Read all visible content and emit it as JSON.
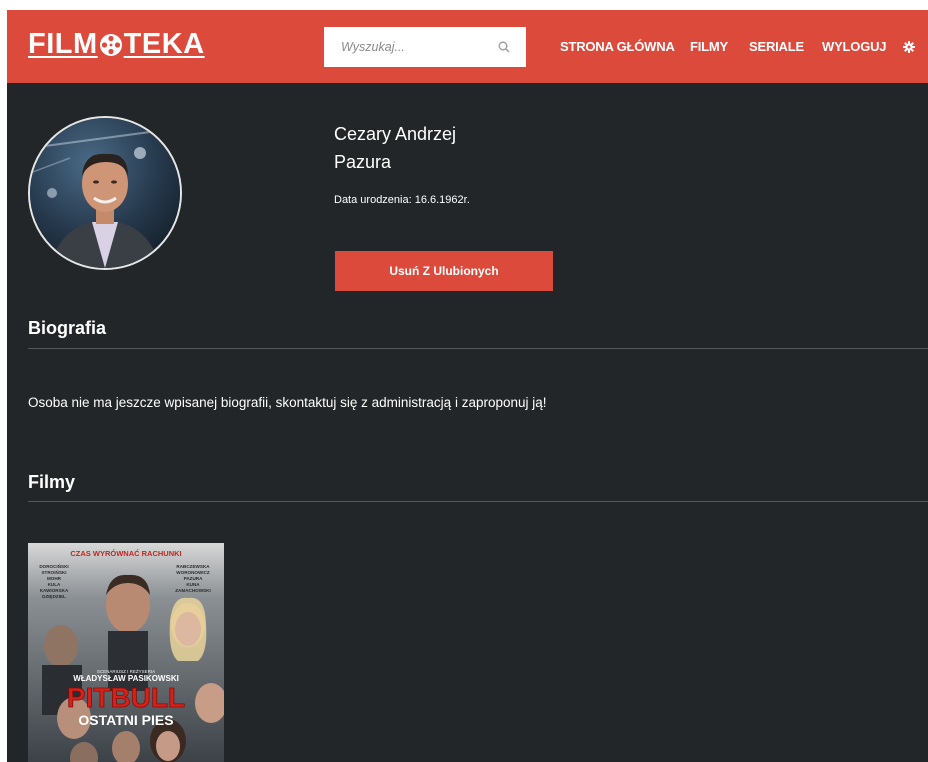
{
  "header": {
    "logo": {
      "before": "FILM",
      "after": "TEKA"
    },
    "search": {
      "placeholder": "Wyszukaj..."
    },
    "nav": [
      "STRONA GŁÓWNA",
      "FILMY",
      "SERIALE",
      "WYLOGUJ"
    ]
  },
  "person": {
    "first_names": "Cezary Andrzej",
    "last_name": "Pazura",
    "birth": "Data urodzenia: 16.6.1962r.",
    "fav_button": "Usuń Z Ulubionych"
  },
  "biography": {
    "title": "Biografia",
    "text": "Osoba nie ma jeszcze wpisanej biografii, skontaktuj się z administracją i zaproponuj ją!"
  },
  "films": {
    "title": "Filmy",
    "items": [
      {
        "tagline": "CZAS WYRÓWNAĆ RACHUNKI",
        "cast_left": [
          "DOROCIŃSKI",
          "STROIŃSKI",
          "MOHR",
          "KULA",
          "KAWIORSKA",
          "DZIĘDZIEL"
        ],
        "cast_right": [
          "RABCZEWSKA",
          "WORONOWICZ",
          "PAZURA",
          "KUNA",
          "ZAMACHOWSKI"
        ],
        "credit_small": "SCENARIUSZ I REŻYSERIA",
        "director": "WŁADYSŁAW PASIKOWSKI",
        "title": "PITBULL",
        "subtitle": "OSTATNI PIES"
      }
    ]
  },
  "colors": {
    "accent": "#dc4a3c",
    "background": "#232628",
    "divider": "#54585b"
  }
}
